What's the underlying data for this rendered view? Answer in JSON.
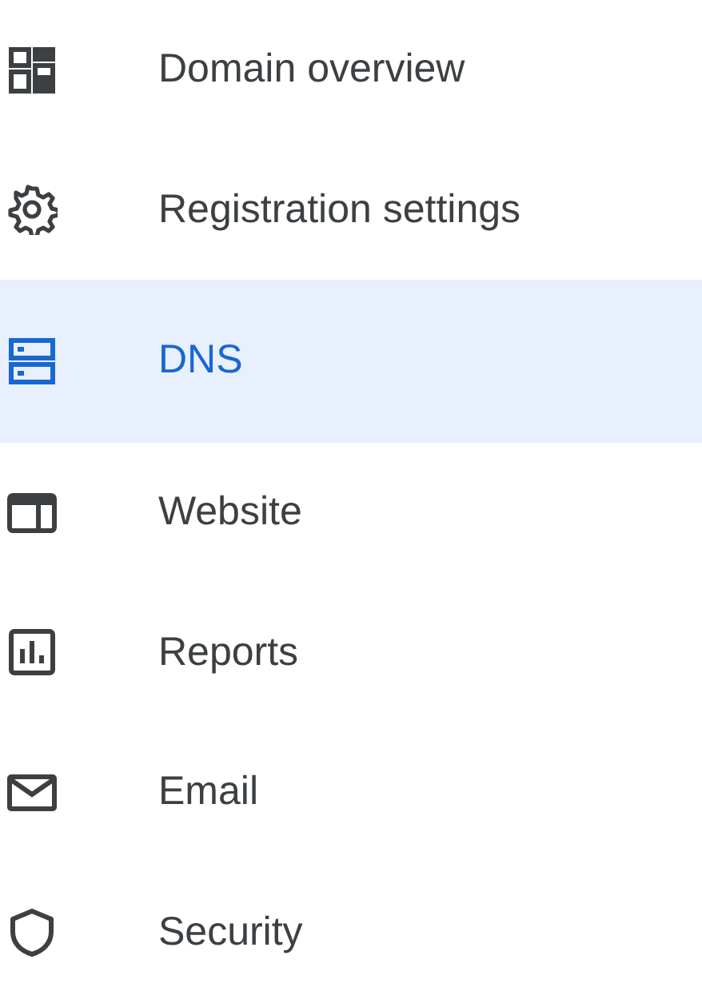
{
  "sidebar": {
    "items": [
      {
        "label": "Domain overview",
        "selected": false
      },
      {
        "label": "Registration settings",
        "selected": false
      },
      {
        "label": "DNS",
        "selected": true
      },
      {
        "label": "Website",
        "selected": false
      },
      {
        "label": "Reports",
        "selected": false
      },
      {
        "label": "Email",
        "selected": false
      },
      {
        "label": "Security",
        "selected": false
      }
    ]
  }
}
